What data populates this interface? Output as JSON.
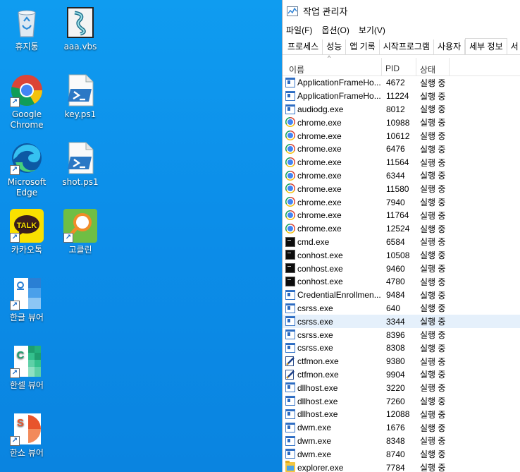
{
  "desktop": {
    "icons": [
      {
        "label": "휴지통",
        "icon": "recycle-bin-icon"
      },
      {
        "label": "aaa.vbs",
        "icon": "vbs-script-icon"
      },
      {
        "label": "Google Chrome",
        "icon": "chrome-icon"
      },
      {
        "label": "key.ps1",
        "icon": "powershell-script-icon"
      },
      {
        "label": "Microsoft Edge",
        "icon": "edge-icon"
      },
      {
        "label": "shot.ps1",
        "icon": "powershell-script-icon"
      },
      {
        "label": "카카오톡",
        "icon": "kakaotalk-icon",
        "badge": "TALK"
      },
      {
        "label": "고클린",
        "icon": "goclean-icon"
      },
      {
        "label": "한글 뷰어",
        "icon": "hangul-viewer-icon"
      },
      {
        "label": "한셀 뷰어",
        "icon": "hancell-viewer-icon",
        "letter": "C"
      },
      {
        "label": "한쇼 뷰어",
        "icon": "hanshow-viewer-icon",
        "letter": "S"
      }
    ]
  },
  "taskmgr": {
    "title": "작업 관리자",
    "menu": [
      "파일(F)",
      "옵션(O)",
      "보기(V)"
    ],
    "tabs": [
      "프로세스",
      "성능",
      "앱 기록",
      "시작프로그램",
      "사용자",
      "세부 정보",
      "서"
    ],
    "active_tab": "세부 정보",
    "columns": {
      "name": "이름",
      "pid": "PID",
      "status": "상태"
    },
    "selected_row": 18,
    "rows": [
      {
        "name": "ApplicationFrameHo...",
        "pid": "4672",
        "status": "실행 중",
        "icon": "window-icon"
      },
      {
        "name": "ApplicationFrameHo...",
        "pid": "11224",
        "status": "실행 중",
        "icon": "window-icon"
      },
      {
        "name": "audiodg.exe",
        "pid": "8012",
        "status": "실행 중",
        "icon": "window-icon"
      },
      {
        "name": "chrome.exe",
        "pid": "10988",
        "status": "실행 중",
        "icon": "chrome-icon"
      },
      {
        "name": "chrome.exe",
        "pid": "10612",
        "status": "실행 중",
        "icon": "chrome-icon"
      },
      {
        "name": "chrome.exe",
        "pid": "6476",
        "status": "실행 중",
        "icon": "chrome-icon"
      },
      {
        "name": "chrome.exe",
        "pid": "11564",
        "status": "실행 중",
        "icon": "chrome-icon"
      },
      {
        "name": "chrome.exe",
        "pid": "6344",
        "status": "실행 중",
        "icon": "chrome-icon"
      },
      {
        "name": "chrome.exe",
        "pid": "11580",
        "status": "실행 중",
        "icon": "chrome-icon"
      },
      {
        "name": "chrome.exe",
        "pid": "7940",
        "status": "실행 중",
        "icon": "chrome-icon"
      },
      {
        "name": "chrome.exe",
        "pid": "11764",
        "status": "실행 중",
        "icon": "chrome-icon"
      },
      {
        "name": "chrome.exe",
        "pid": "12524",
        "status": "실행 중",
        "icon": "chrome-icon"
      },
      {
        "name": "cmd.exe",
        "pid": "6584",
        "status": "실행 중",
        "icon": "console-icon"
      },
      {
        "name": "conhost.exe",
        "pid": "10508",
        "status": "실행 중",
        "icon": "console-icon"
      },
      {
        "name": "conhost.exe",
        "pid": "9460",
        "status": "실행 중",
        "icon": "console-icon"
      },
      {
        "name": "conhost.exe",
        "pid": "4780",
        "status": "실행 중",
        "icon": "console-icon"
      },
      {
        "name": "CredentialEnrollmen...",
        "pid": "9484",
        "status": "실행 중",
        "icon": "window-icon"
      },
      {
        "name": "csrss.exe",
        "pid": "640",
        "status": "실행 중",
        "icon": "window-icon"
      },
      {
        "name": "csrss.exe",
        "pid": "3344",
        "status": "실행 중",
        "icon": "window-icon"
      },
      {
        "name": "csrss.exe",
        "pid": "8396",
        "status": "실행 중",
        "icon": "window-icon"
      },
      {
        "name": "csrss.exe",
        "pid": "8308",
        "status": "실행 중",
        "icon": "window-icon"
      },
      {
        "name": "ctfmon.exe",
        "pid": "9380",
        "status": "실행 중",
        "icon": "ctfmon-icon"
      },
      {
        "name": "ctfmon.exe",
        "pid": "9904",
        "status": "실행 중",
        "icon": "ctfmon-icon"
      },
      {
        "name": "dllhost.exe",
        "pid": "3220",
        "status": "실행 중",
        "icon": "window-icon"
      },
      {
        "name": "dllhost.exe",
        "pid": "7260",
        "status": "실행 중",
        "icon": "window-icon"
      },
      {
        "name": "dllhost.exe",
        "pid": "12088",
        "status": "실행 중",
        "icon": "window-icon"
      },
      {
        "name": "dwm.exe",
        "pid": "1676",
        "status": "실행 중",
        "icon": "window-icon"
      },
      {
        "name": "dwm.exe",
        "pid": "8348",
        "status": "실행 중",
        "icon": "window-icon"
      },
      {
        "name": "dwm.exe",
        "pid": "8740",
        "status": "실행 중",
        "icon": "window-icon"
      },
      {
        "name": "explorer.exe",
        "pid": "7784",
        "status": "실행 중",
        "icon": "explorer-folder-icon"
      }
    ]
  }
}
